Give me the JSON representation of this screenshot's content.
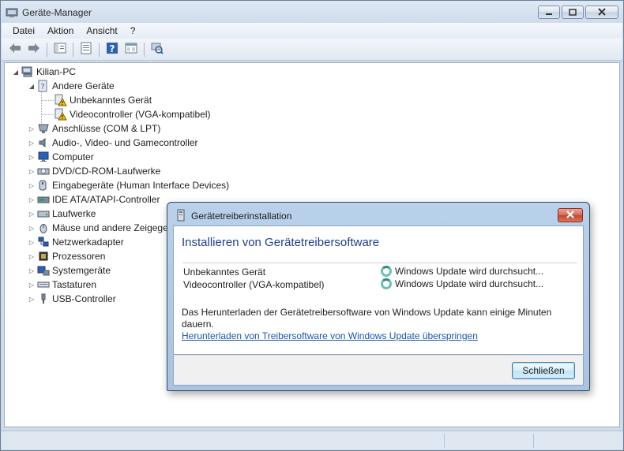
{
  "window": {
    "title": "Geräte-Manager",
    "minimize": "minimize",
    "maximize": "maximize",
    "close": "close"
  },
  "menu": [
    "Datei",
    "Aktion",
    "Ansicht",
    "?"
  ],
  "toolbar": {
    "icons": [
      "back-arrow-icon",
      "forward-arrow-icon",
      "console-tree-icon",
      "properties-icon",
      "help-icon",
      "view-icon",
      "scan-hardware-icon"
    ]
  },
  "tree": {
    "root": "Kilian-PC",
    "other_devices": "Andere Geräte",
    "other_children": [
      "Unbekanntes Gerät",
      "Videocontroller (VGA-kompatibel)"
    ],
    "categories": [
      "Anschlüsse (COM & LPT)",
      "Audio-, Video- und Gamecontroller",
      "Computer",
      "DVD/CD-ROM-Laufwerke",
      "Eingabegeräte (Human Interface Devices)",
      "IDE ATA/ATAPI-Controller",
      "Laufwerke",
      "Mäuse und andere Zeigegeräte",
      "Netzwerkadapter",
      "Prozessoren",
      "Systemgeräte",
      "Tastaturen",
      "USB-Controller"
    ]
  },
  "dialog": {
    "title": "Gerätetreiberinstallation",
    "heading": "Installieren von Gerätetreibersoftware",
    "devices": [
      {
        "name": "Unbekanntes Gerät",
        "status": "Windows Update wird durchsucht..."
      },
      {
        "name": "Videocontroller (VGA-kompatibel)",
        "status": "Windows Update wird durchsucht..."
      }
    ],
    "info": "Das Herunterladen der Gerätetreibersoftware von Windows Update kann einige Minuten dauern.",
    "link": "Herunterladen von Treibersoftware von Windows Update überspringen",
    "close_button": "Schließen"
  },
  "colors": {
    "accent_heading": "#1f3f8a",
    "link": "#1a55b0",
    "spinner": "#2d8b80",
    "close_red": "#c2462f"
  }
}
